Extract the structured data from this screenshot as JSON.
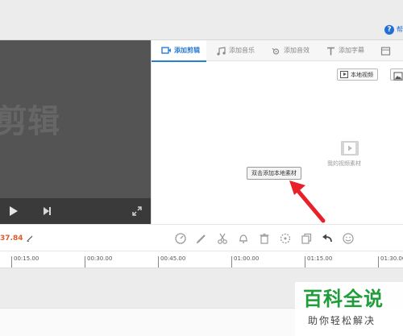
{
  "header": {
    "help_label": "帮",
    "help_icon": "help-icon"
  },
  "preview": {
    "watermark_text": "剪辑",
    "controls": [
      "play-icon",
      "next-frame-icon",
      "fullscreen-icon"
    ]
  },
  "panel": {
    "tabs": [
      {
        "label": "添加剪辑",
        "icon": "video-clip-icon",
        "active": true
      },
      {
        "label": "添加音乐",
        "icon": "music-icon",
        "active": false
      },
      {
        "label": "添加音效",
        "icon": "sound-effect-icon",
        "active": false
      },
      {
        "label": "添加字幕",
        "icon": "subtitle-icon",
        "active": false
      },
      {
        "label": "",
        "icon": "overflow-tab-icon",
        "active": false
      }
    ],
    "local_video_label": "本地视频",
    "media_caption": "我的视频素材",
    "add_local_label": "双击添加本地素材"
  },
  "toolbar": {
    "time_value": "37.84",
    "tools": [
      "speed-icon",
      "edit-icon",
      "cut-icon",
      "bell-icon",
      "delete-icon",
      "effects-icon",
      "copy-icon",
      "undo-icon",
      "emoji-icon"
    ]
  },
  "timeline": {
    "ticks": [
      "00:15.00",
      "00:30.00",
      "00:45.00",
      "01:00.00",
      "01:15.00",
      "01:30.00"
    ]
  },
  "brand": {
    "title": "百科全说",
    "subtitle": "助你轻松解决"
  },
  "colors": {
    "accent": "#2b7cd3",
    "time": "#e05a2b",
    "arrow": "#e8202a",
    "brand": "#1f9d3a"
  }
}
